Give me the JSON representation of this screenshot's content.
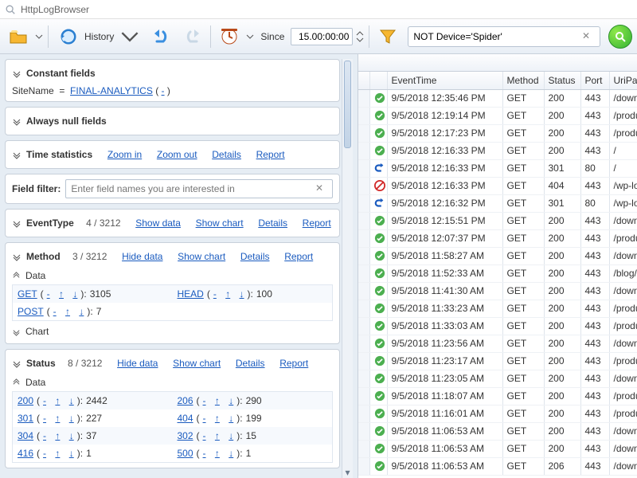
{
  "app": {
    "title": "HttpLogBrowser"
  },
  "toolbar": {
    "history_label": "History",
    "since_label": "Since",
    "since_value": "15.00:00:00",
    "filter_text": "NOT Device='Spider'"
  },
  "constant_fields": {
    "title": "Constant fields",
    "items": [
      {
        "name": "SiteName",
        "value": "FINAL-ANALYTICS"
      }
    ]
  },
  "always_null": {
    "title": "Always null fields"
  },
  "time_stats": {
    "title": "Time statistics",
    "zoom_in": "Zoom in",
    "zoom_out": "Zoom out",
    "details": "Details",
    "report": "Report"
  },
  "field_filter": {
    "title": "Field filter:",
    "placeholder": "Enter field names you are interested in"
  },
  "event_type": {
    "title": "EventType",
    "shown": 4,
    "total": 3212,
    "show_data": "Show data",
    "show_chart": "Show chart",
    "details": "Details",
    "report": "Report"
  },
  "method": {
    "title": "Method",
    "shown": 3,
    "total": 3212,
    "hide_data": "Hide data",
    "show_chart": "Show chart",
    "details": "Details",
    "report": "Report",
    "data_label": "Data",
    "chart_label": "Chart",
    "values": [
      {
        "name": "GET",
        "count": 3105
      },
      {
        "name": "HEAD",
        "count": 100
      },
      {
        "name": "POST",
        "count": 7
      }
    ]
  },
  "status": {
    "title": "Status",
    "shown": 8,
    "total": 3212,
    "hide_data": "Hide data",
    "show_chart": "Show chart",
    "details": "Details",
    "report": "Report",
    "data_label": "Data",
    "values": [
      {
        "name": "200",
        "count": 2442
      },
      {
        "name": "206",
        "count": 290
      },
      {
        "name": "301",
        "count": 227
      },
      {
        "name": "404",
        "count": 199
      },
      {
        "name": "304",
        "count": 37
      },
      {
        "name": "302",
        "count": 15
      },
      {
        "name": "416",
        "count": 1
      },
      {
        "name": "500",
        "count": 1
      }
    ]
  },
  "grid": {
    "headers": {
      "time": "EventTime",
      "method": "Method",
      "status": "Status",
      "port": "Port",
      "uri": "UriPath"
    },
    "rows": [
      {
        "icon": "ok",
        "time": "9/5/2018 12:35:46 PM",
        "method": "GET",
        "status": 200,
        "port": 443,
        "uri": "/down"
      },
      {
        "icon": "ok",
        "time": "9/5/2018 12:19:14 PM",
        "method": "GET",
        "status": 200,
        "port": 443,
        "uri": "/produ"
      },
      {
        "icon": "ok",
        "time": "9/5/2018 12:17:23 PM",
        "method": "GET",
        "status": 200,
        "port": 443,
        "uri": "/produ"
      },
      {
        "icon": "ok",
        "time": "9/5/2018 12:16:33 PM",
        "method": "GET",
        "status": 200,
        "port": 443,
        "uri": "/"
      },
      {
        "icon": "redir",
        "time": "9/5/2018 12:16:33 PM",
        "method": "GET",
        "status": 301,
        "port": 80,
        "uri": "/"
      },
      {
        "icon": "error",
        "time": "9/5/2018 12:16:33 PM",
        "method": "GET",
        "status": 404,
        "port": 443,
        "uri": "/wp-lo"
      },
      {
        "icon": "redir",
        "time": "9/5/2018 12:16:32 PM",
        "method": "GET",
        "status": 301,
        "port": 80,
        "uri": "/wp-lo"
      },
      {
        "icon": "ok",
        "time": "9/5/2018 12:15:51 PM",
        "method": "GET",
        "status": 200,
        "port": 443,
        "uri": "/down"
      },
      {
        "icon": "ok",
        "time": "9/5/2018 12:07:37 PM",
        "method": "GET",
        "status": 200,
        "port": 443,
        "uri": "/produ"
      },
      {
        "icon": "ok",
        "time": "9/5/2018 11:58:27 AM",
        "method": "GET",
        "status": 200,
        "port": 443,
        "uri": "/down"
      },
      {
        "icon": "ok",
        "time": "9/5/2018 11:52:33 AM",
        "method": "GET",
        "status": 200,
        "port": 443,
        "uri": "/blog/"
      },
      {
        "icon": "ok",
        "time": "9/5/2018 11:41:30 AM",
        "method": "GET",
        "status": 200,
        "port": 443,
        "uri": "/down"
      },
      {
        "icon": "ok",
        "time": "9/5/2018 11:33:23 AM",
        "method": "GET",
        "status": 200,
        "port": 443,
        "uri": "/produ"
      },
      {
        "icon": "ok",
        "time": "9/5/2018 11:33:03 AM",
        "method": "GET",
        "status": 200,
        "port": 443,
        "uri": "/produ"
      },
      {
        "icon": "ok",
        "time": "9/5/2018 11:23:56 AM",
        "method": "GET",
        "status": 200,
        "port": 443,
        "uri": "/down"
      },
      {
        "icon": "ok",
        "time": "9/5/2018 11:23:17 AM",
        "method": "GET",
        "status": 200,
        "port": 443,
        "uri": "/produ"
      },
      {
        "icon": "ok",
        "time": "9/5/2018 11:23:05 AM",
        "method": "GET",
        "status": 200,
        "port": 443,
        "uri": "/down"
      },
      {
        "icon": "ok",
        "time": "9/5/2018 11:18:07 AM",
        "method": "GET",
        "status": 200,
        "port": 443,
        "uri": "/produ"
      },
      {
        "icon": "ok",
        "time": "9/5/2018 11:16:01 AM",
        "method": "GET",
        "status": 200,
        "port": 443,
        "uri": "/produ"
      },
      {
        "icon": "ok",
        "time": "9/5/2018 11:06:53 AM",
        "method": "GET",
        "status": 200,
        "port": 443,
        "uri": "/down"
      },
      {
        "icon": "ok",
        "time": "9/5/2018 11:06:53 AM",
        "method": "GET",
        "status": 200,
        "port": 443,
        "uri": "/down"
      },
      {
        "icon": "ok",
        "time": "9/5/2018 11:06:53 AM",
        "method": "GET",
        "status": 206,
        "port": 443,
        "uri": "/down"
      }
    ]
  },
  "glyphs": {
    "minus": "-",
    "up": "↑",
    "down": "↓",
    "close": "✕"
  }
}
